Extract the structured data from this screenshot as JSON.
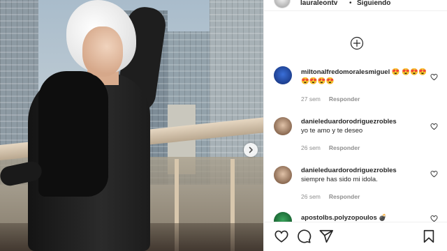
{
  "post": {
    "username": "lauraleontv",
    "separator": "•",
    "follow_status": "Siguiendo"
  },
  "comments": [
    {
      "username": "miltonalfredomoralesmiguel",
      "text": "😍 😍😍😍😍😍😍😍",
      "age": "27 sem",
      "reply": "Responder"
    },
    {
      "username": "danieleduardorodriguezrobles",
      "text": "yo te amo y te deseo",
      "age": "26 sem",
      "reply": "Responder"
    },
    {
      "username": "danieleduardorodriguezrobles",
      "text": "siempre has sido mi idola.",
      "age": "26 sem",
      "reply": "Responder"
    },
    {
      "username": "apostolbs.polyzopoulos",
      "text": "💣",
      "age": "",
      "reply": ""
    }
  ],
  "icons": {
    "add": "plus-circle-icon",
    "like": "heart-icon",
    "comment": "comment-icon",
    "share": "paper-plane-icon",
    "save": "bookmark-icon",
    "next": "chevron-right-icon"
  },
  "colors": {
    "text": "#262626",
    "muted": "#8e8e8e",
    "border": "#efefef"
  }
}
